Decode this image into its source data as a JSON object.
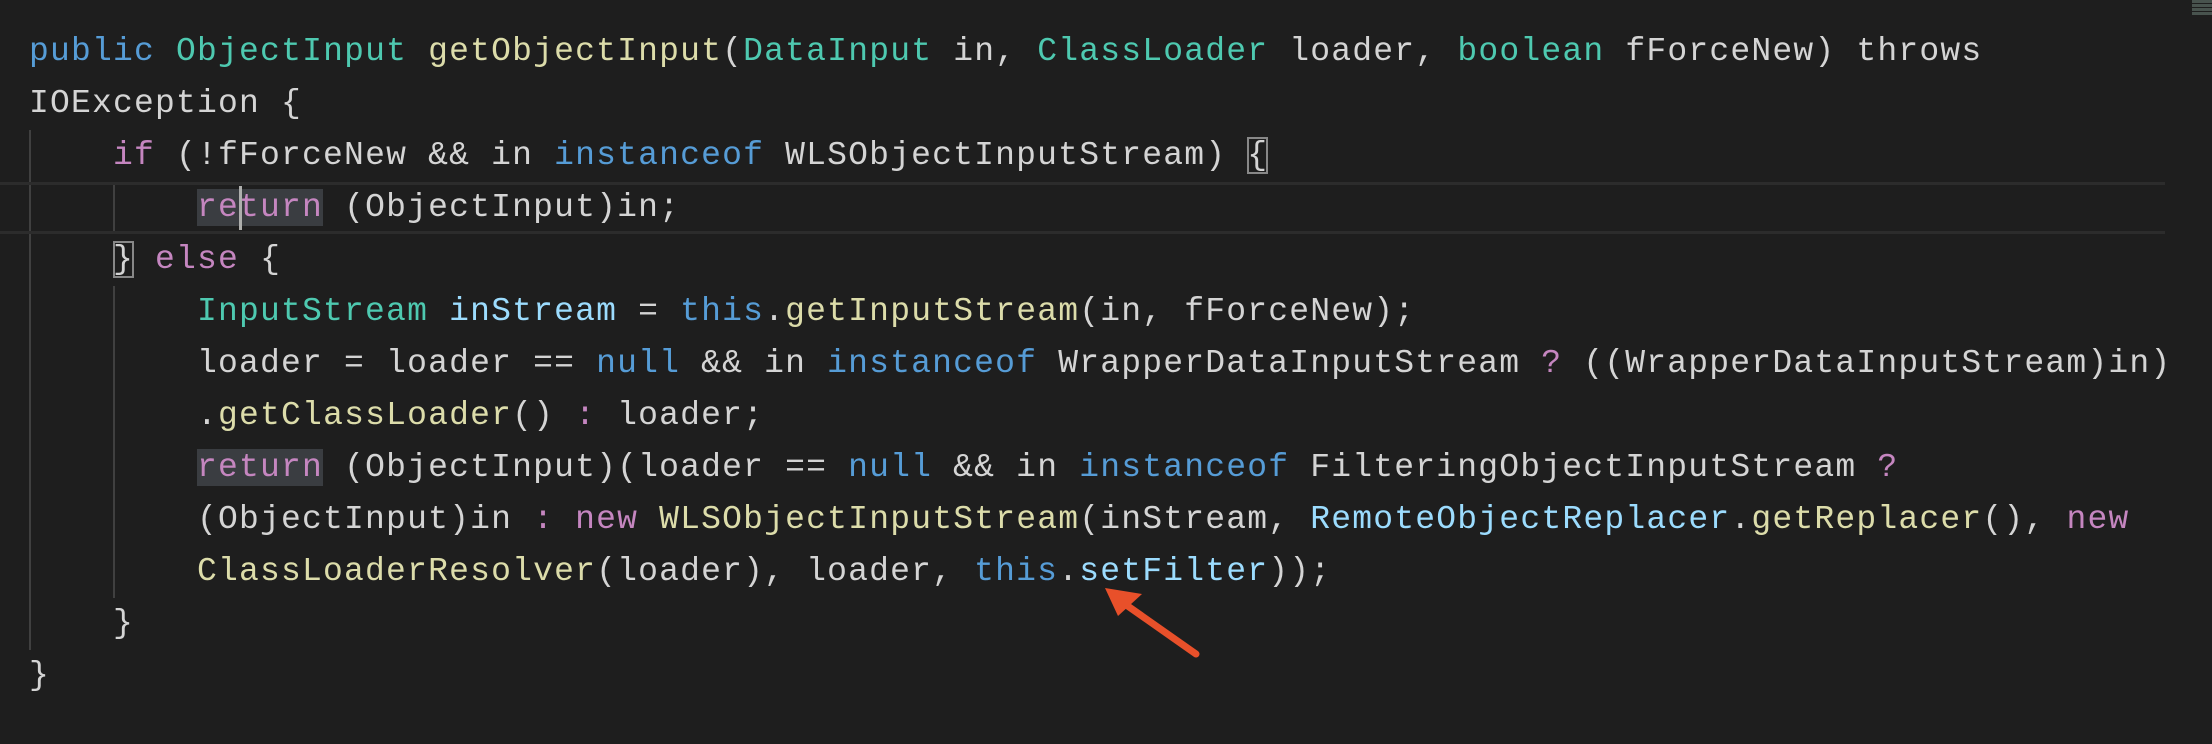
{
  "editor": {
    "theme_colors": {
      "background": "#1e1e1e",
      "keyword": "#569cd6",
      "type": "#4ec9b0",
      "function": "#dcdcaa",
      "control": "#c586c0",
      "variable": "#9cdcfe",
      "text": "#d4d4d4",
      "annotation_arrow": "#e8502a"
    },
    "current_line": 3,
    "lines": [
      {
        "indent": 0,
        "tokens": [
          [
            "public",
            "kw"
          ],
          [
            " ",
            "txt"
          ],
          [
            "ObjectInput",
            "type"
          ],
          [
            " ",
            "txt"
          ],
          [
            "getObjectInput",
            "fn"
          ],
          [
            "(",
            "txt"
          ],
          [
            "DataInput",
            "type"
          ],
          [
            " in, ",
            "txt"
          ],
          [
            "ClassLoader",
            "type"
          ],
          [
            " loader, ",
            "txt"
          ],
          [
            "boolean",
            "type"
          ],
          [
            " fForceNew) throws",
            "txt"
          ]
        ]
      },
      {
        "indent": 0,
        "tokens": [
          [
            "IOException {",
            "txt"
          ]
        ]
      },
      {
        "indent": 4,
        "tokens": [
          [
            "if",
            "ctl"
          ],
          [
            " (!fForceNew && in ",
            "txt"
          ],
          [
            "instanceof",
            "kw"
          ],
          [
            " WLSObjectInputStream) ",
            "txt"
          ],
          [
            "{",
            "txt",
            "bm"
          ]
        ]
      },
      {
        "indent": 8,
        "tokens": [
          [
            "return",
            "ctl",
            "hl"
          ],
          [
            " (ObjectInput)in;",
            "txt"
          ]
        ]
      },
      {
        "indent": 4,
        "tokens": [
          [
            "}",
            "txt",
            "bm"
          ],
          [
            " ",
            "txt"
          ],
          [
            "else",
            "ctl"
          ],
          [
            " {",
            "txt"
          ]
        ]
      },
      {
        "indent": 8,
        "tokens": [
          [
            "InputStream",
            "type"
          ],
          [
            " ",
            "txt"
          ],
          [
            "inStream",
            "var"
          ],
          [
            " = ",
            "txt"
          ],
          [
            "this",
            "kw"
          ],
          [
            ".",
            "txt"
          ],
          [
            "getInputStream",
            "fn"
          ],
          [
            "(in, fForceNew);",
            "txt"
          ]
        ]
      },
      {
        "indent": 8,
        "tokens": [
          [
            "loader = loader == ",
            "txt"
          ],
          [
            "null",
            "kw"
          ],
          [
            " && in ",
            "txt"
          ],
          [
            "instanceof",
            "kw"
          ],
          [
            " WrapperDataInputStream ",
            "txt"
          ],
          [
            "?",
            "ctl"
          ],
          [
            " ((WrapperDataInputStream)in)",
            "txt"
          ]
        ]
      },
      {
        "indent": 8,
        "tokens": [
          [
            ".",
            "txt"
          ],
          [
            "getClassLoader",
            "fn"
          ],
          [
            "() ",
            "txt"
          ],
          [
            ":",
            "ctl"
          ],
          [
            " loader;",
            "txt"
          ]
        ]
      },
      {
        "indent": 8,
        "tokens": [
          [
            "return",
            "ctl",
            "hl"
          ],
          [
            " (ObjectInput)(loader == ",
            "txt"
          ],
          [
            "null",
            "kw"
          ],
          [
            " && in ",
            "txt"
          ],
          [
            "instanceof",
            "kw"
          ],
          [
            " FilteringObjectInputStream ",
            "txt"
          ],
          [
            "?",
            "ctl"
          ]
        ]
      },
      {
        "indent": 8,
        "tokens": [
          [
            "(ObjectInput)in ",
            "txt"
          ],
          [
            ":",
            "ctl"
          ],
          [
            " ",
            "txt"
          ],
          [
            "new",
            "ctl"
          ],
          [
            " ",
            "txt"
          ],
          [
            "WLSObjectInputStream",
            "fn"
          ],
          [
            "(inStream, ",
            "txt"
          ],
          [
            "RemoteObjectReplacer",
            "var"
          ],
          [
            ".",
            "txt"
          ],
          [
            "getReplacer",
            "fn"
          ],
          [
            "(), ",
            "txt"
          ],
          [
            "new",
            "ctl"
          ]
        ]
      },
      {
        "indent": 8,
        "tokens": [
          [
            "ClassLoaderResolver",
            "fn"
          ],
          [
            "(loader), loader, ",
            "txt"
          ],
          [
            "this",
            "kw"
          ],
          [
            ".",
            "txt"
          ],
          [
            "setFilter",
            "var"
          ],
          [
            "));",
            "txt"
          ]
        ]
      },
      {
        "indent": 4,
        "tokens": [
          [
            "}",
            "txt"
          ]
        ]
      },
      {
        "indent": 0,
        "tokens": [
          [
            "}",
            "txt"
          ]
        ]
      }
    ]
  }
}
